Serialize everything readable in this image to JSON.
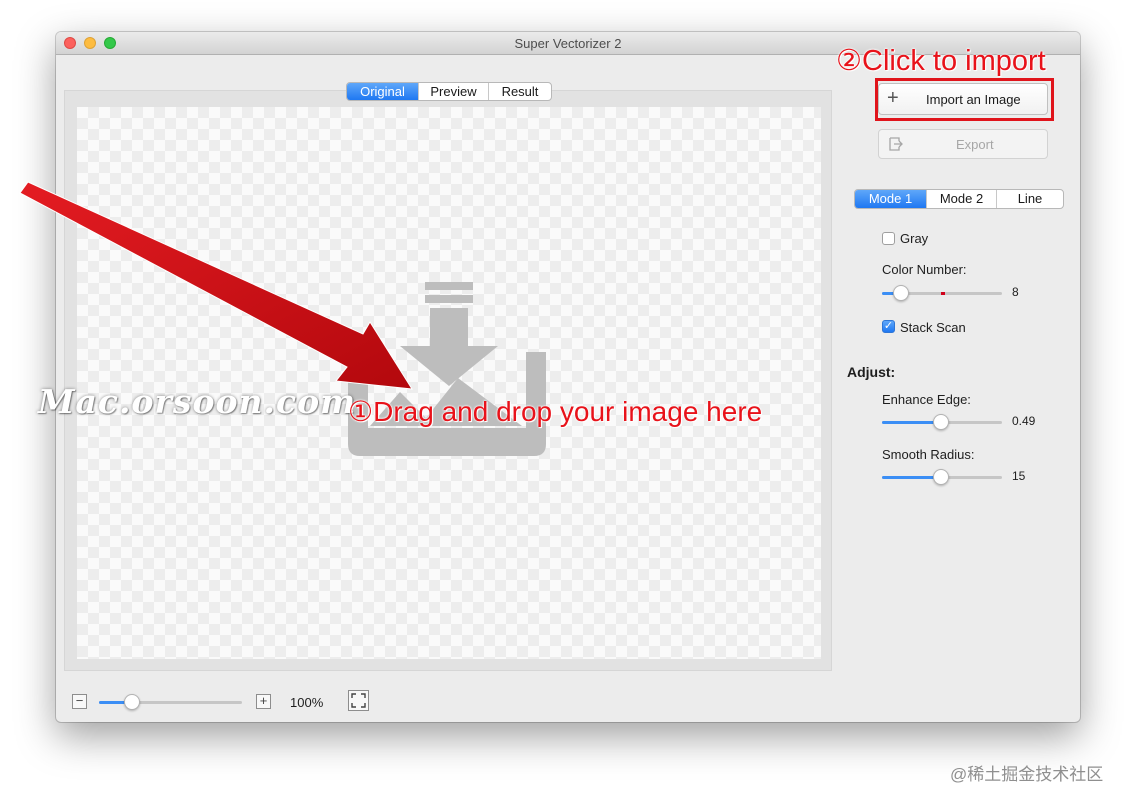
{
  "window": {
    "title": "Super Vectorizer 2"
  },
  "view_tabs": [
    {
      "label": "Original",
      "selected": true
    },
    {
      "label": "Preview",
      "selected": false
    },
    {
      "label": "Result",
      "selected": false
    }
  ],
  "sidebar": {
    "import_label": "Import an Image",
    "export_label": "Export",
    "mode_tabs": [
      {
        "label": "Mode 1",
        "selected": true
      },
      {
        "label": "Mode 2",
        "selected": false
      },
      {
        "label": "Line",
        "selected": false
      }
    ],
    "gray": {
      "label": "Gray",
      "checked": false
    },
    "color_number": {
      "label": "Color Number:",
      "value": "8"
    },
    "stack_scan": {
      "label": "Stack Scan",
      "checked": true
    },
    "adjust_heading": "Adjust:",
    "enhance_edge": {
      "label": "Enhance Edge:",
      "value": "0.49"
    },
    "smooth_radius": {
      "label": "Smooth Radius:",
      "value": "15"
    }
  },
  "zoom": {
    "value": "100%"
  },
  "annotations": {
    "drag": "①Drag and drop your image here",
    "import": "②Click to import",
    "color": "#e8121a"
  },
  "watermark": "Mac.orsoon.com",
  "credit": "@稀土掘金技术社区",
  "icons": [
    "import-image-icon",
    "plus-icon",
    "export-icon",
    "minus-icon",
    "fullscreen-icon"
  ]
}
